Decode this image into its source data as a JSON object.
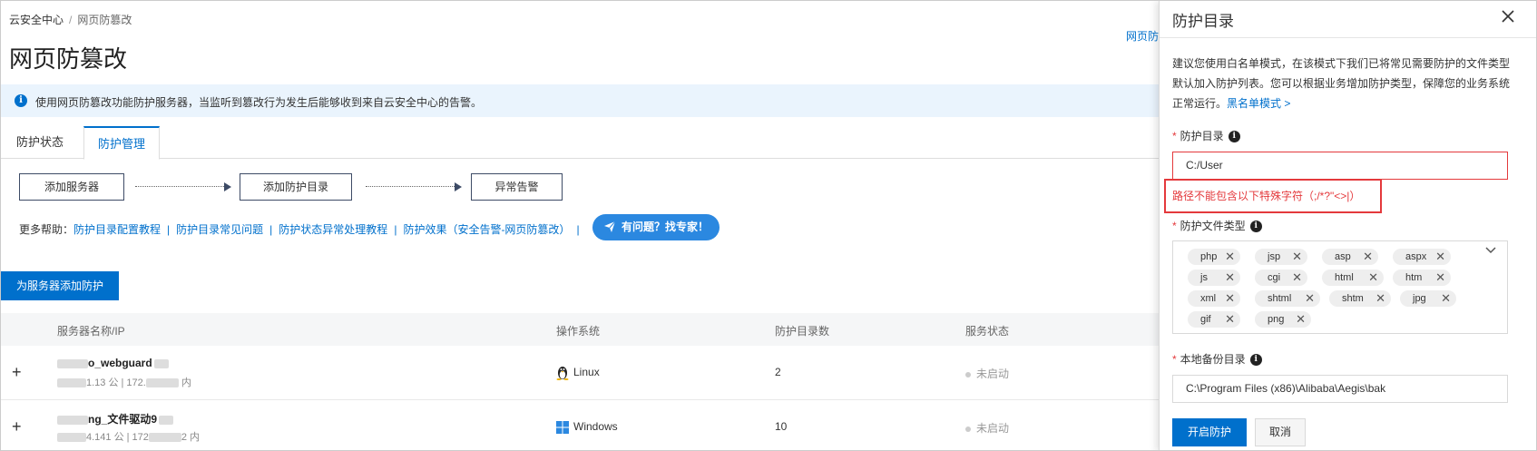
{
  "breadcrumb": {
    "root": "云安全中心",
    "sep": "/",
    "current": "网页防篡改"
  },
  "page_title": "网页防篡改",
  "top_link": "网页防",
  "info_bar": {
    "icon": "info-icon",
    "text": "使用网页防篡改功能防护服务器，当监听到篡改行为发生后能够收到来自云安全中心的告警。"
  },
  "tabs": [
    {
      "label": "防护状态"
    },
    {
      "label": "防护管理",
      "active": true
    }
  ],
  "steps": [
    {
      "label": "添加服务器"
    },
    {
      "label": "添加防护目录"
    },
    {
      "label": "异常告警"
    }
  ],
  "help": {
    "prefix": "更多帮助：",
    "links": [
      "防护目录配置教程",
      "防护目录常见问题",
      "防护状态异常处理教程",
      "防护效果（安全告警-网页防篡改）"
    ],
    "sep": "|",
    "expert_button": "有问题？找专家！"
  },
  "add_button": "为服务器添加防护",
  "table": {
    "columns": [
      "服务器名称/IP",
      "操作系统",
      "防护目录数",
      "服务状态"
    ],
    "rows": [
      {
        "expand": "+",
        "name": "o_webguard",
        "ip_a": "1.13 公 | 172.",
        "ip_b": "内",
        "os": "Linux",
        "os_icon": "linux-icon",
        "count": "2",
        "status": "未启动"
      },
      {
        "expand": "+",
        "name": "ng_文件驱动9",
        "ip_a": "4.141 公 | 172",
        "ip_b": "2 内",
        "os": "Windows",
        "os_icon": "windows-icon",
        "count": "10",
        "status": "未启动"
      }
    ]
  },
  "drawer": {
    "title": "防护目录",
    "close_icon": "close-icon",
    "description": "建议您使用白名单模式，在该模式下我们已将常见需要防护的文件类型默认加入防护列表。您可以根据业务增加防护类型，保障您的业务系统正常运行。",
    "blacklist_link": "黑名单模式 >",
    "dir_label": "防护目录",
    "required_mark": "*",
    "help_icon_glyph": "i",
    "dir_value": "C:/User",
    "dir_error": "路径不能包含以下特殊字符（;/*?\"<>|）",
    "filetype_label": "防护文件类型",
    "filetypes": [
      "php",
      "jsp",
      "asp",
      "aspx",
      "js",
      "cgi",
      "html",
      "htm",
      "xml",
      "shtml",
      "shtm",
      "jpg",
      "gif",
      "png"
    ],
    "tag_remove": "✕",
    "backup_label": "本地备份目录",
    "backup_value": "C:\\Program Files (x86)\\Alibaba\\Aegis\\bak",
    "ok_button": "开启防护",
    "cancel_button": "取消"
  }
}
